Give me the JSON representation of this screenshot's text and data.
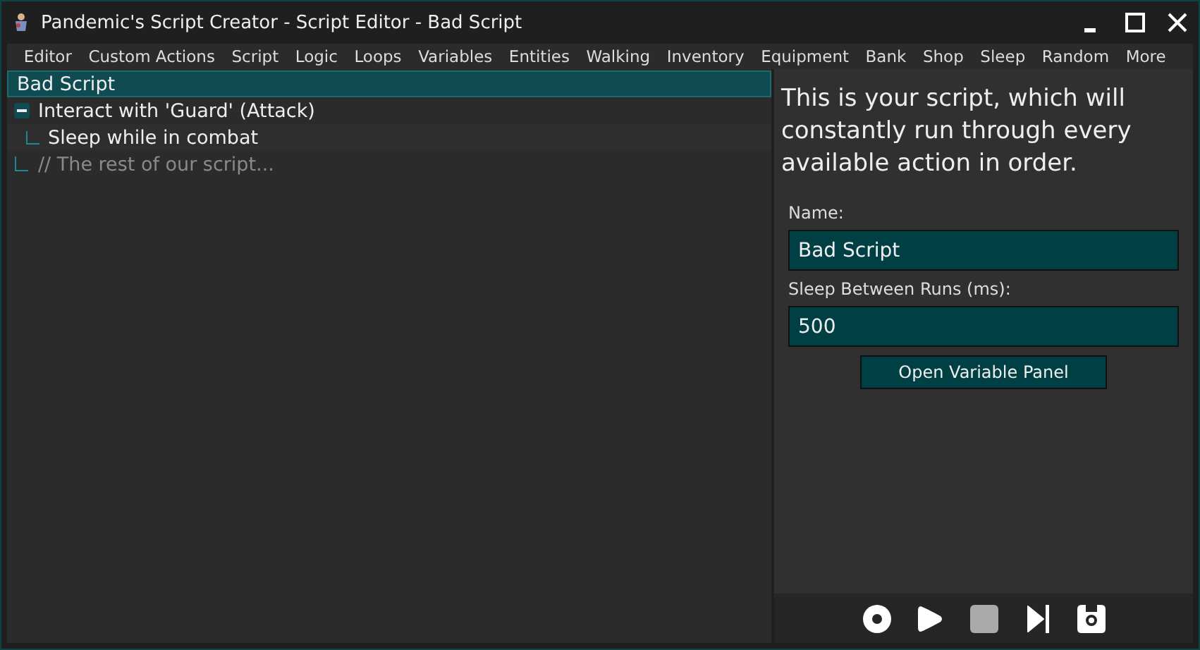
{
  "window": {
    "title": "Pandemic's Script Creator - Script Editor - Bad Script"
  },
  "menu": [
    "Editor",
    "Custom Actions",
    "Script",
    "Logic",
    "Loops",
    "Variables",
    "Entities",
    "Walking",
    "Inventory",
    "Equipment",
    "Bank",
    "Shop",
    "Sleep",
    "Random",
    "More"
  ],
  "tree": {
    "label": "Bad Script",
    "selected": true,
    "children": [
      {
        "label": "Interact with 'Guard' (Attack)",
        "kind": "action",
        "expanded": true,
        "selected": false,
        "children": [
          {
            "label": "Sleep while in combat",
            "kind": "action",
            "selected": false
          }
        ]
      },
      {
        "label": "// The rest of our script...",
        "kind": "comment",
        "selected": false
      }
    ]
  },
  "details": {
    "description": "This is your script, which will constantly run through every available action in order.",
    "fields": [
      {
        "label": "Name:",
        "value": "Bad Script"
      },
      {
        "label": "Sleep Between Runs (ms):",
        "value": "500"
      }
    ],
    "button": "Open Variable Panel"
  },
  "toolbar": [
    {
      "kind": "record",
      "disabled": false
    },
    {
      "kind": "play",
      "disabled": false
    },
    {
      "kind": "stop",
      "disabled": true
    },
    {
      "kind": "step",
      "disabled": false
    },
    {
      "kind": "save",
      "disabled": false
    }
  ]
}
